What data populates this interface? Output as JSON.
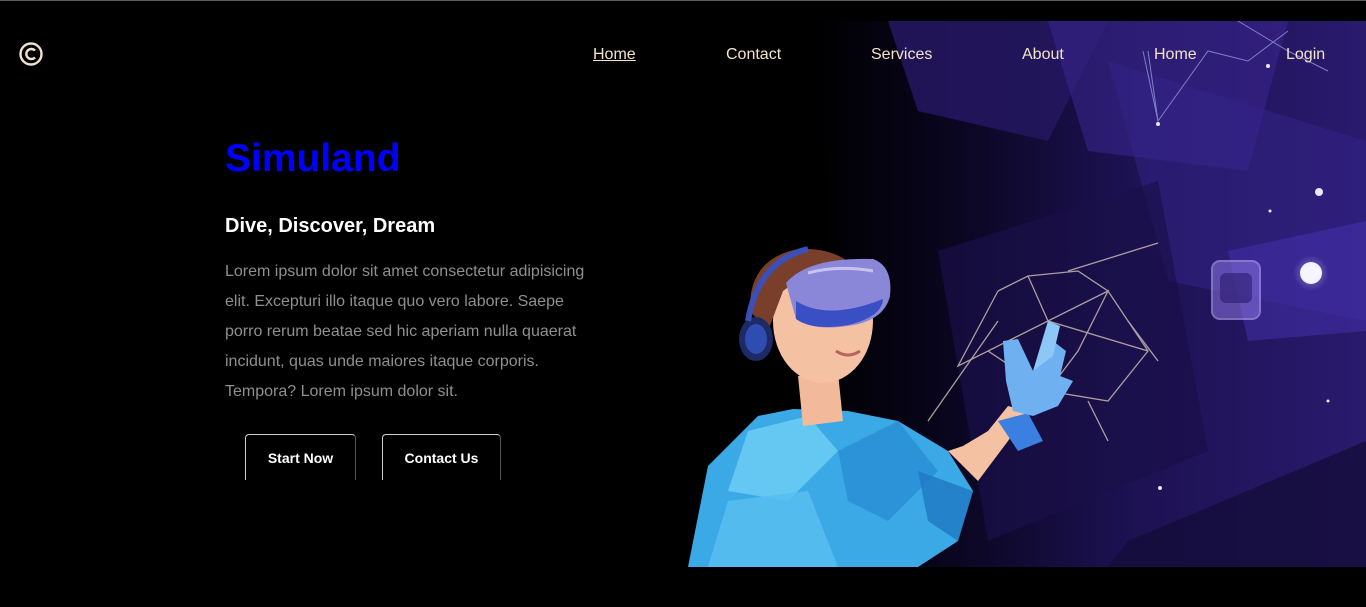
{
  "brand": {
    "logo_icon": "copyright-icon",
    "color": "#f1e3c9"
  },
  "nav": {
    "items": [
      {
        "label": "Home",
        "active": true
      },
      {
        "label": "Contact"
      },
      {
        "label": "Services"
      },
      {
        "label": "About"
      },
      {
        "label": "Home"
      },
      {
        "label": "Login"
      }
    ]
  },
  "hero": {
    "title": "Simuland",
    "subtitle": "Dive, Discover, Dream",
    "description": "Lorem ipsum dolor sit amet consectetur adipisicing elit. Excepturi illo itaque quo vero labore. Saepe porro rerum beatae sed hic aperiam nulla quaerat incidunt, quas unde maiores itaque corporis. Tempora? Lorem ipsum dolor sit.",
    "buttons": {
      "start": "Start Now",
      "contact": "Contact Us"
    },
    "illustration": "vr-headset-person-illustration"
  },
  "colors": {
    "title": "#0000ff",
    "nav_text": "#f1e3c9",
    "background": "#000000",
    "art_purple": "#2a1a6e"
  }
}
